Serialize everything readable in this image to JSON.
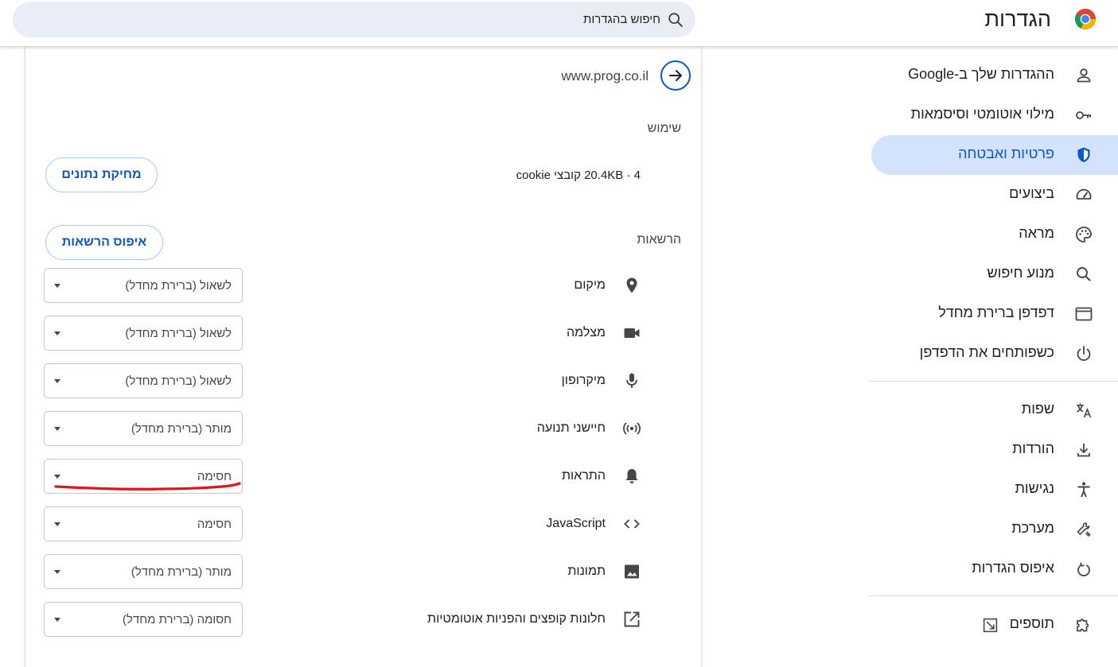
{
  "header": {
    "title": "הגדרות",
    "search_placeholder": "חיפוש בהגדרות"
  },
  "sidebar": {
    "items": [
      {
        "label": "ההגדרות שלך ב-Google",
        "icon": "person-icon",
        "active": false
      },
      {
        "label": "מילוי אוטומטי וסיסמאות",
        "icon": "key-icon",
        "active": false
      },
      {
        "label": "פרטיות ואבטחה",
        "icon": "shield-icon",
        "active": true
      },
      {
        "label": "ביצועים",
        "icon": "speedometer-icon",
        "active": false
      },
      {
        "label": "מראה",
        "icon": "palette-icon",
        "active": false
      },
      {
        "label": "מנוע חיפוש",
        "icon": "search-icon",
        "active": false
      },
      {
        "label": "דפדפן ברירת מחדל",
        "icon": "browser-window-icon",
        "active": false
      },
      {
        "label": "כשפותחים את הדפדפן",
        "icon": "power-icon",
        "active": false
      },
      {
        "label": "שפות",
        "icon": "translate-icon",
        "active": false
      },
      {
        "label": "הורדות",
        "icon": "download-icon",
        "active": false
      },
      {
        "label": "נגישות",
        "icon": "accessibility-icon",
        "active": false
      },
      {
        "label": "מערכת",
        "icon": "wrench-icon",
        "active": false
      },
      {
        "label": "איפוס הגדרות",
        "icon": "reset-icon",
        "active": false
      },
      {
        "label": "תוספים",
        "icon": "puzzle-icon",
        "active": false
      }
    ]
  },
  "site": {
    "url": "www.prog.co.il",
    "usage_title": "שימוש",
    "usage_text": "4 · 20.4KB קובצי cookie",
    "clear_data_label": "מחיקת נתונים",
    "permissions_title": "הרשאות",
    "reset_permissions_label": "איפוס הרשאות"
  },
  "permissions": [
    {
      "label": "מיקום",
      "icon": "location-pin-icon",
      "value": "לשאול (ברירת מחדל)"
    },
    {
      "label": "מצלמה",
      "icon": "camera-icon",
      "value": "לשאול (ברירת מחדל)"
    },
    {
      "label": "מיקרופון",
      "icon": "microphone-icon",
      "value": "לשאול (ברירת מחדל)"
    },
    {
      "label": "חיישני תנועה",
      "icon": "motion-sensor-icon",
      "value": "מותר (ברירת מחדל)"
    },
    {
      "label": "התראות",
      "icon": "bell-icon",
      "value": "חסימה"
    },
    {
      "label": "JavaScript",
      "icon": "code-icon",
      "value": "חסימה"
    },
    {
      "label": "תמונות",
      "icon": "image-icon",
      "value": "מותר (ברירת מחדל)"
    },
    {
      "label": "חלונות קופצים והפניות אוטומטיות",
      "icon": "open-external-icon",
      "value": "חסומה (ברירת מחדל)"
    }
  ],
  "colors": {
    "accent": "#0b57d0",
    "active_bg": "#d3e3fd",
    "annotation_red": "#e0151b"
  }
}
